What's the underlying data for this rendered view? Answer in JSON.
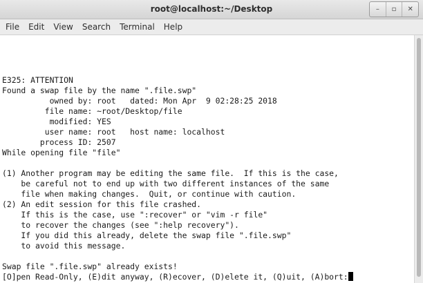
{
  "window": {
    "title": "root@localhost:~/Desktop",
    "controls": {
      "minimize": "–",
      "maximize": "▫",
      "close": "✕"
    }
  },
  "menu": [
    "File",
    "Edit",
    "View",
    "Search",
    "Terminal",
    "Help"
  ],
  "terminal": {
    "lines": [
      "E325: ATTENTION",
      "Found a swap file by the name \".file.swp\"",
      "          owned by: root   dated: Mon Apr  9 02:28:25 2018",
      "         file name: ~root/Desktop/file",
      "          modified: YES",
      "         user name: root   host name: localhost",
      "        process ID: 2507",
      "While opening file \"file\"",
      "",
      "(1) Another program may be editing the same file.  If this is the case,",
      "    be careful not to end up with two different instances of the same",
      "    file when making changes.  Quit, or continue with caution.",
      "(2) An edit session for this file crashed.",
      "    If this is the case, use \":recover\" or \"vim -r file\"",
      "    to recover the changes (see \":help recovery\").",
      "    If you did this already, delete the swap file \".file.swp\"",
      "    to avoid this message.",
      "",
      "Swap file \".file.swp\" already exists!"
    ],
    "prompt": "[O]pen Read-Only, (E)dit anyway, (R)ecover, (D)elete it, (Q)uit, (A)bort:"
  }
}
